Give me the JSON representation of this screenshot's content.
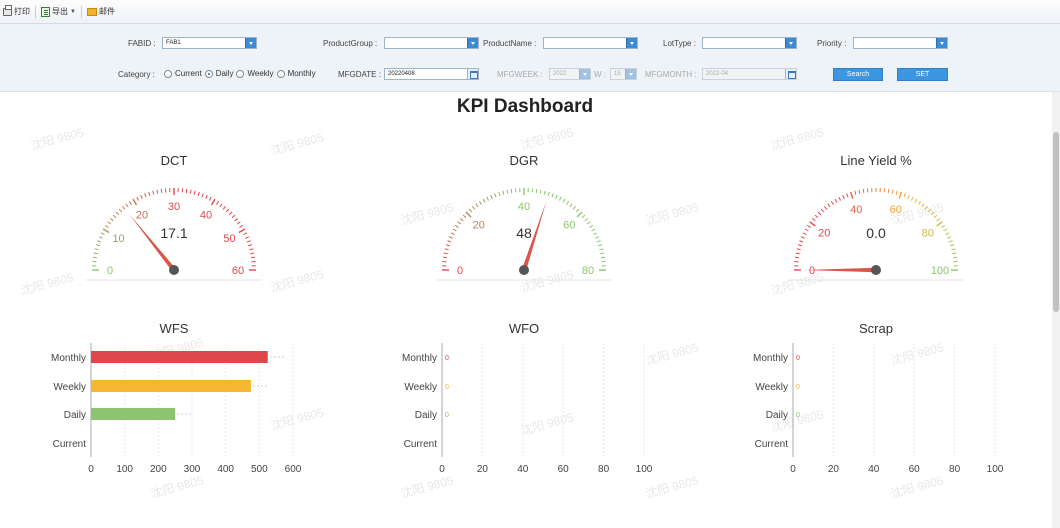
{
  "toolbar": {
    "print_label": "打印",
    "export_label": "导出",
    "mail_label": "邮件"
  },
  "filters": {
    "fabid_label": "FABID :",
    "fabid_value": "FAB1",
    "productgroup_label": "ProductGroup :",
    "productgroup_value": "",
    "productname_label": "ProductName :",
    "productname_value": "",
    "lottype_label": "LotType :",
    "lottype_value": "",
    "priority_label": "Priority :",
    "priority_value": "",
    "category_label": "Category :",
    "category_options": [
      "Current",
      "Daily",
      "Weekly",
      "Monthly"
    ],
    "category_selected": "Daily",
    "mfgdate_label": "MFGDATE :",
    "mfgdate_value": "20220408",
    "mfgweek_label": "MFGWEEK :",
    "mfgweek_year": "2022",
    "mfgweek_w_label": "W :",
    "mfgweek_week": "15",
    "mfgmonth_label": "MFGMONTH :",
    "mfgmonth_value": "2022-04",
    "search_label": "Search",
    "set_label": "SET"
  },
  "dashboard": {
    "title": "KPI Dashboard"
  },
  "watermark": "沈阳 9805",
  "colors": {
    "red": "#e0474c",
    "yellow": "#f5b731",
    "green": "#8cc46f",
    "needle": "#d9554a",
    "accent_blue": "#3d96e0"
  },
  "chart_data": [
    {
      "type": "gauge",
      "title": "DCT",
      "value": 17.1,
      "value_label": "17.1",
      "min": 0,
      "max": 60,
      "ticks": [
        0,
        10,
        20,
        30,
        40,
        50,
        60
      ]
    },
    {
      "type": "gauge",
      "title": "DGR",
      "value": 48,
      "value_label": "48",
      "min": 0,
      "max": 80,
      "ticks": [
        0,
        20,
        40,
        60,
        80
      ]
    },
    {
      "type": "gauge",
      "title": "Line Yield %",
      "value": 0.0,
      "value_label": "0.0",
      "min": 0,
      "max": 100,
      "ticks": [
        0,
        20,
        40,
        60,
        80,
        100
      ]
    },
    {
      "type": "bar",
      "orientation": "horizontal",
      "title": "WFS",
      "categories": [
        "Monthly",
        "Weekly",
        "Daily",
        "Current"
      ],
      "values": [
        525,
        475,
        250,
        0
      ],
      "xlim": [
        0,
        600
      ],
      "xticks": [
        0,
        100,
        200,
        300,
        400,
        500,
        600
      ],
      "bar_labels": [
        "",
        "",
        "",
        ""
      ]
    },
    {
      "type": "bar",
      "orientation": "horizontal",
      "title": "WFO",
      "categories": [
        "Monthly",
        "Weekly",
        "Daily",
        "Current"
      ],
      "values": [
        0,
        0,
        0,
        0
      ],
      "xlim": [
        0,
        100
      ],
      "xticks": [
        0,
        20,
        40,
        60,
        80,
        100
      ],
      "bar_labels": [
        "0",
        "0",
        "0",
        ""
      ]
    },
    {
      "type": "bar",
      "orientation": "horizontal",
      "title": "Scrap",
      "categories": [
        "Monthly",
        "Weekly",
        "Daily",
        "Current"
      ],
      "values": [
        0,
        0,
        0,
        0
      ],
      "xlim": [
        0,
        100
      ],
      "xticks": [
        0,
        20,
        40,
        60,
        80,
        100
      ],
      "bar_labels": [
        "0",
        "0",
        "0",
        ""
      ]
    }
  ]
}
